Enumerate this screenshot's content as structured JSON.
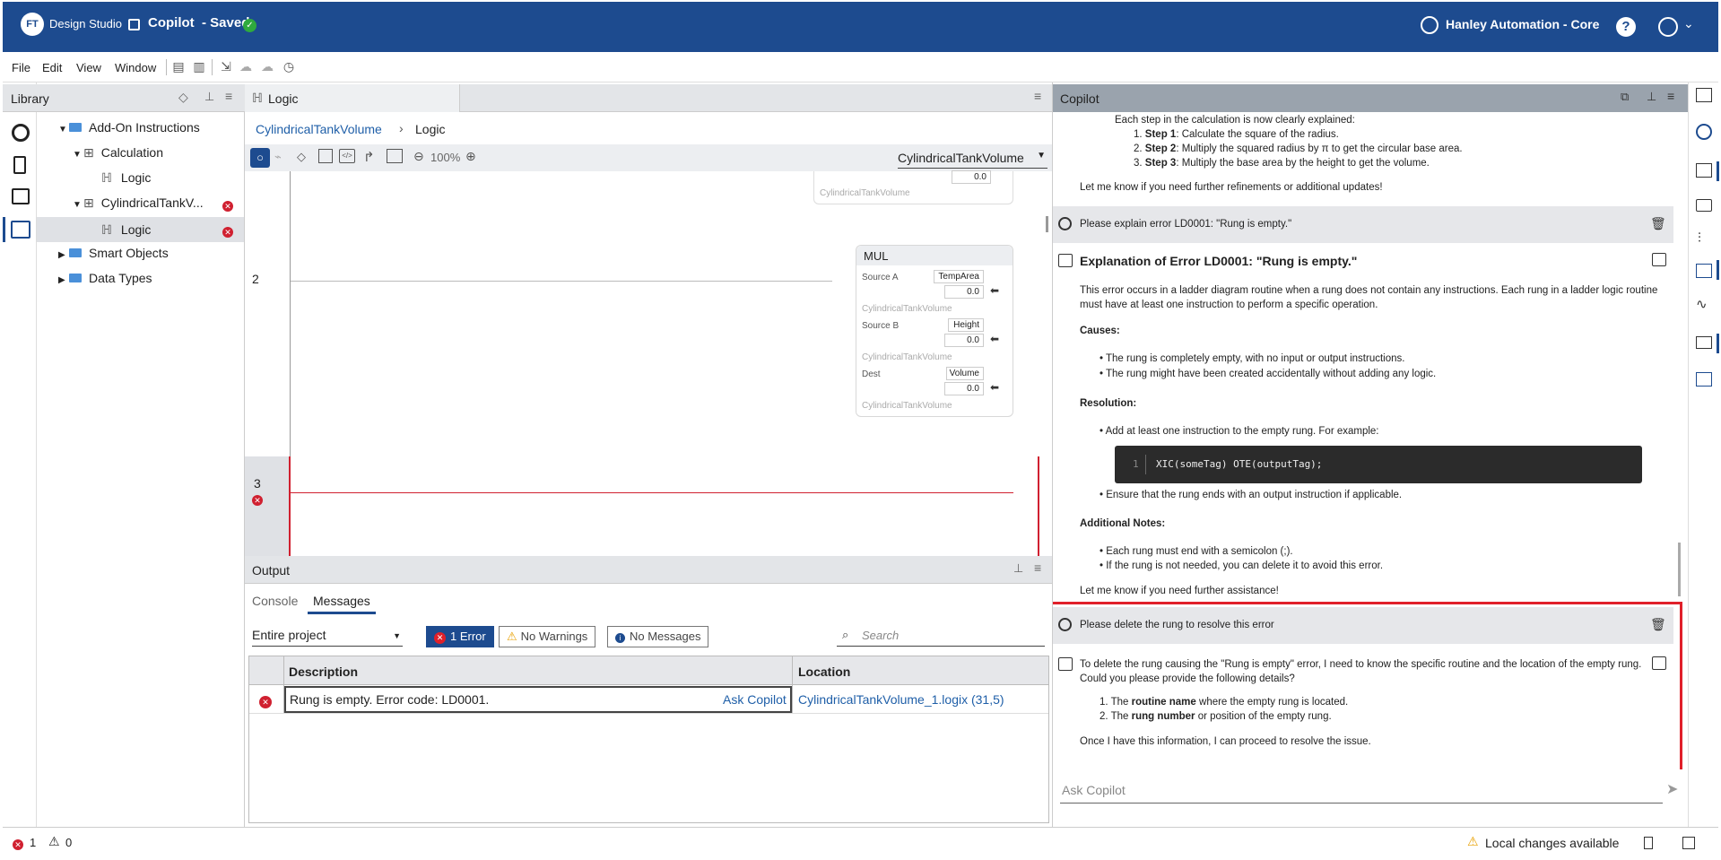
{
  "header": {
    "brand_bold": "FT",
    "brand_rest": "Design Studio",
    "doc_title": "Copilot",
    "save_status": "- Saved",
    "org_name": "Hanley Automation - Core"
  },
  "menu": [
    "File",
    "Edit",
    "View",
    "Window"
  ],
  "library": {
    "title": "Library",
    "tree": [
      {
        "label": "Add-On Instructions"
      },
      {
        "label": "Calculation"
      },
      {
        "label": "Logic"
      },
      {
        "label": "CylindricalTankV..."
      },
      {
        "label": "Logic"
      },
      {
        "label": "Smart Objects"
      },
      {
        "label": "Data Types"
      }
    ]
  },
  "logic": {
    "tab": "Logic",
    "breadcrumb_parent": "CylindricalTankVolume",
    "breadcrumb_sep": "›",
    "breadcrumb_current": "Logic",
    "zoom": "100%",
    "routine_select": "CylindricalTankVolume",
    "top_block": {
      "value": "0.0",
      "tag_desc": "CylindricalTankVolume"
    },
    "rung2": {
      "number": "2",
      "instr": "MUL",
      "rows": [
        {
          "label": "Source A",
          "tag": "TempArea",
          "value": "0.0",
          "desc": "CylindricalTankVolume"
        },
        {
          "label": "Source B",
          "tag": "Height",
          "value": "0.0",
          "desc": "CylindricalTankVolume"
        },
        {
          "label": "Dest",
          "tag": "Volume",
          "value": "0.0",
          "desc": "CylindricalTankVolume"
        }
      ]
    },
    "rung3": {
      "number": "3"
    }
  },
  "output": {
    "title": "Output",
    "tabs": [
      "Console",
      "Messages"
    ],
    "scope": "Entire project",
    "errors": "1 Error",
    "warnings": "No Warnings",
    "messages": "No Messages",
    "search_placeholder": "Search",
    "columns": [
      "Description",
      "Location"
    ],
    "rows": [
      {
        "description": "Rung is empty. Error code: LD0001.",
        "action": "Ask Copilot",
        "location": "CylindricalTankVolume_1.logix (31,5)"
      }
    ]
  },
  "copilot": {
    "title": "Copilot",
    "block0": {
      "intro": "Each step in the calculation is now clearly explained:",
      "steps": [
        {
          "b": "Step 1",
          "t": ": Calculate the square of the radius."
        },
        {
          "b": "Step 2",
          "t": ": Multiply the squared radius by π to get the circular base area."
        },
        {
          "b": "Step 3",
          "t": ": Multiply the base area by the height to get the volume."
        }
      ],
      "outro": "Let me know if you need further refinements or additional updates!"
    },
    "user1": "Please explain error LD0001: \"Rung is empty.\"",
    "resp1": {
      "heading": "Explanation of Error LD0001: \"Rung is empty.\"",
      "para": "This error occurs in a ladder diagram routine when a rung does not contain any instructions. Each rung in a ladder logic routine must have at least one instruction to perform a specific operation.",
      "causes_title": "Causes:",
      "causes": [
        "The rung is completely empty, with no input or output instructions.",
        "The rung might have been created accidentally without adding any logic."
      ],
      "resolution_title": "Resolution:",
      "res1": "Add at least one instruction to the empty rung. For example:",
      "code_line": "1",
      "code": "XIC(someTag) OTE(outputTag);",
      "res2": "Ensure that the rung ends with an output instruction if applicable.",
      "notes_title": "Additional Notes:",
      "notes": [
        "Each rung must end with a semicolon (;).",
        "If the rung is not needed, you can delete it to avoid this error."
      ],
      "outro": "Let me know if you need further assistance!"
    },
    "user2": "Please delete the rung to resolve this error",
    "resp2": {
      "para": "To delete the rung causing the \"Rung is empty\" error, I need to know the specific routine and the location of the empty rung. Could you please provide the following details?",
      "items": [
        {
          "b": "routine name",
          "pre": "The ",
          "post": " where the empty rung is located."
        },
        {
          "b": "rung number",
          "pre": "The ",
          "post": " or position of the empty rung."
        }
      ],
      "outro": "Once I have this information, I can proceed to resolve the issue."
    },
    "input_placeholder": "Ask Copilot"
  },
  "status": {
    "errors": "1",
    "warnings": "0",
    "changes": "Local changes available"
  },
  "colors": {
    "brand": "#1d4b8f",
    "error": "#d02030",
    "highlight": "#e0202a",
    "link": "#1f5fa8"
  }
}
